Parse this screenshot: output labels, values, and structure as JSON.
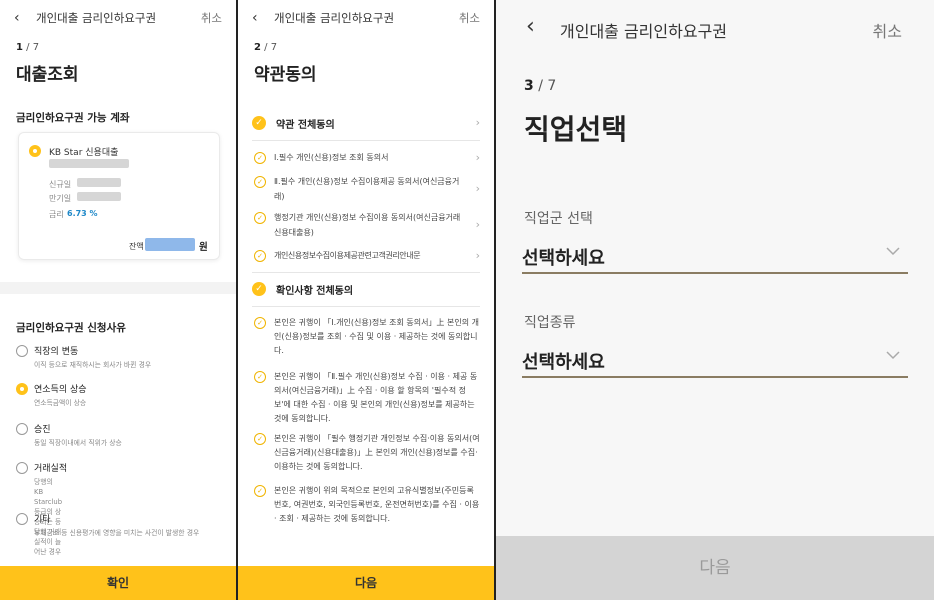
{
  "header": {
    "title": "개인대출 금리인하요구권",
    "cancel": "취소"
  },
  "panel1": {
    "step_current": "1",
    "step_total": "/ 7",
    "title": "대출조회",
    "eligible_label": "금리인하요구권 가능 계좌",
    "account": {
      "name": "KB Star 신용대출",
      "new_date_label": "신규일",
      "maturity_label": "만기일",
      "rate_label": "금리",
      "rate_value": "6.73 %",
      "balance_label": "잔액",
      "balance_unit": "원"
    },
    "reason_label": "금리인하요구권 신청사유",
    "reasons": [
      {
        "title": "직장의 변동",
        "desc": "이직 등으로 재직하시는 회사가 바뀐 경우",
        "selected": false
      },
      {
        "title": "연소득의 상승",
        "desc": "연소득금액이 상승",
        "selected": true
      },
      {
        "title": "승진",
        "desc": "동일 직장이내에서 직위가 상승",
        "selected": false
      },
      {
        "title": "거래실적",
        "desc": "당행의 KB Starclub등급의 상승되는 등 당행 거래실적이 늘\n어난 경우",
        "selected": false
      },
      {
        "title": "기타",
        "desc": "부채감소 등 신용평가에 영향을 미치는 사건이 발생한 경우",
        "selected": false
      }
    ],
    "confirm": "확인"
  },
  "panel2": {
    "step_current": "2",
    "step_total": "/ 7",
    "title": "약관동의",
    "all_terms": "약관 전체동의",
    "terms": [
      "Ⅰ.필수 개인(신용)정보 조회 동의서",
      "Ⅱ.필수 개인(신용)정보 수집이용제공 동의서(여신금융거래)",
      "행정기관 개인(신용)정보 수집이용 동의서(여신금융거래 신용대출용)",
      "개인신용정보수집이용제공관련고객권리안내문"
    ],
    "all_confirm": "확인사항 전체동의",
    "confirms": [
      "본인은 귀행이 「Ⅰ.개인(신용)정보 조회 동의서」上 본인의 개인(신용)정보를 조회 · 수집 및 이용 · 제공하는 것에 동의합니다.",
      "본인은 귀행이 「Ⅱ.필수 개인(신용)정보 수집 · 이용 · 제공 동의서(여신금융거래)」上 수집 · 이용 할 항목의 '필수적 정보'에 대한 수집 · 이용 및 본인의 개인(신용)정보를 제공하는 것에 동의합니다.",
      "본인은 귀행이 「필수 행정기관 개인정보 수집·이용 동의서(여신금융거래)(신용대출용)」上 본인의 개인(신용)정보를 수집·이용하는 것에 동의합니다.",
      "본인은 귀행이 위의 목적으로 본인의 고유식별정보(주민등록번호, 여권번호, 외국인등록번호, 운전면허번호)를 수집 · 이용 · 조회 · 제공하는 것에 동의합니다."
    ],
    "next": "다음"
  },
  "panel3": {
    "step_current": "3",
    "step_total": "/ 7",
    "title": "직업선택",
    "job_group_label": "직업군 선택",
    "job_group_value": "선택하세요",
    "job_type_label": "직업종류",
    "job_type_value": "선택하세요",
    "next": "다음"
  },
  "colors": {
    "accent": "#ffc21a",
    "rate_text": "#1e88c8",
    "disabled_button": "#d4d4d4"
  },
  "icons": {
    "back": "chevron-left-icon",
    "chevron": "chevron-right-icon",
    "check": "check-circle-icon",
    "dropdown": "chevron-down-icon"
  }
}
